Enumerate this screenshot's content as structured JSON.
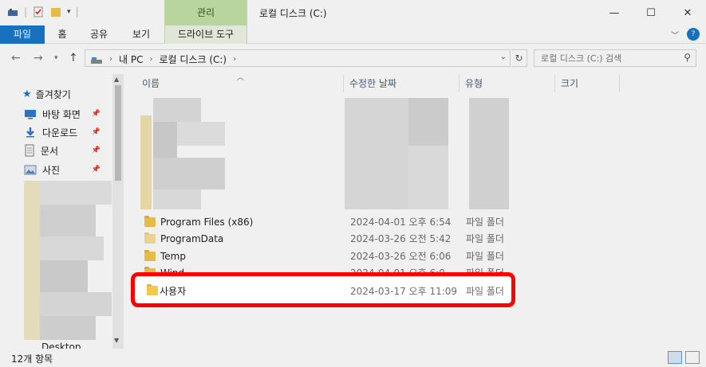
{
  "window": {
    "title": "로컬 디스크 (C:)",
    "contextual_tab": "관리"
  },
  "ribbon": {
    "tabs": [
      "파일",
      "홈",
      "공유",
      "보기",
      "드라이브 도구"
    ]
  },
  "nav": {
    "breadcrumb": [
      "내 PC",
      "로컬 디스크 (C:)"
    ],
    "search_placeholder": "로컬 디스크 (C:) 검색"
  },
  "sidebar": {
    "quick_access": "즐겨찾기",
    "items": [
      {
        "label": "바탕 화면",
        "icon": "desktop-icon",
        "pinned": true
      },
      {
        "label": "다운로드",
        "icon": "download-icon",
        "pinned": true
      },
      {
        "label": "문서",
        "icon": "document-icon",
        "pinned": true
      },
      {
        "label": "사진",
        "icon": "pictures-icon",
        "pinned": true
      }
    ],
    "partial_bottom_label": "Desktop"
  },
  "columns": {
    "name": "이름",
    "modified": "수정한 날짜",
    "type": "유형",
    "size": "크기"
  },
  "files": [
    {
      "name": "Program Files (x86)",
      "date": "2024-04-01 오후 6:54",
      "type": "파일 폴더"
    },
    {
      "name": "ProgramData",
      "date": "2024-03-26 오전 5:42",
      "type": "파일 폴더"
    },
    {
      "name": "Temp",
      "date": "2024-03-26 오전 6:06",
      "type": "파일 폴더"
    },
    {
      "name": "Wind",
      "date": "2024-04-01 오후 6:0",
      "type": "파일 폴더"
    }
  ],
  "highlighted_file": {
    "name": "사용자",
    "date": "2024-03-17 오후 11:09",
    "type": "파일 폴더"
  },
  "status": {
    "item_count": "12개 항목"
  },
  "colors": {
    "highlight_border": "#ff0000",
    "file_tab": "#1979ca",
    "manage_tab": "#c5e3a8",
    "folder": "#f4c84e"
  }
}
